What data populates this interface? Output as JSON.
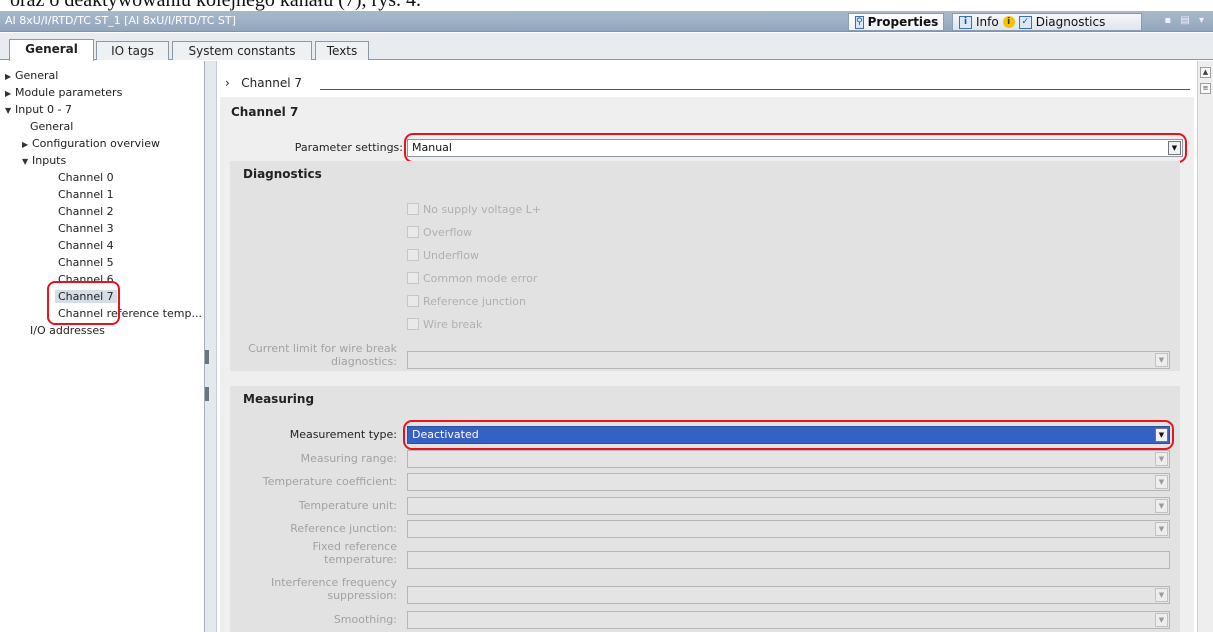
{
  "document_caption": "oraz o deaktywowaniu kolejnego kanału (7), rys. 4.",
  "window": {
    "title": "AI 8xU/I/RTD/TC ST_1 [AI 8xU/I/RTD/TC ST]",
    "tabs": [
      {
        "label": "Properties",
        "icon": "properties-icon"
      },
      {
        "label": "Info",
        "icon": "info-icon"
      },
      {
        "label": "Diagnostics",
        "icon": "diagnostics-icon"
      }
    ]
  },
  "inspector_tabs": [
    "General",
    "IO tags",
    "System constants",
    "Texts"
  ],
  "tree": [
    {
      "label": "General",
      "arrow": "▶"
    },
    {
      "label": "Module parameters",
      "arrow": "▶"
    },
    {
      "label": "Input 0 - 7",
      "arrow": "▼"
    },
    {
      "label": "General",
      "arrow": ""
    },
    {
      "label": "Configuration overview",
      "arrow": "▶"
    },
    {
      "label": "Inputs",
      "arrow": "▼"
    },
    {
      "label": "Channel 0",
      "arrow": ""
    },
    {
      "label": "Channel 1",
      "arrow": ""
    },
    {
      "label": "Channel 2",
      "arrow": ""
    },
    {
      "label": "Channel 3",
      "arrow": ""
    },
    {
      "label": "Channel 4",
      "arrow": ""
    },
    {
      "label": "Channel 5",
      "arrow": ""
    },
    {
      "label": "Channel 6",
      "arrow": ""
    },
    {
      "label": "Channel 7",
      "arrow": ""
    },
    {
      "label": "Channel reference temp...",
      "arrow": ""
    },
    {
      "label": "I/O addresses",
      "arrow": ""
    }
  ],
  "breadcrumb": {
    "arrow": "›",
    "label": "Channel 7"
  },
  "channel": {
    "title": "Channel 7",
    "parameter_settings_label": "Parameter settings:",
    "parameter_settings_value": "Manual"
  },
  "diagnostics": {
    "title": "Diagnostics",
    "checkboxes": [
      "No supply voltage L+",
      "Overflow",
      "Underflow",
      "Common mode error",
      "Reference junction",
      "Wire break"
    ],
    "current_limit_label_1": "Current limit for wire break",
    "current_limit_label_2": "diagnostics:"
  },
  "measuring": {
    "title": "Measuring",
    "measurement_type_label": "Measurement type:",
    "measurement_type_value": "Deactivated",
    "fields": {
      "measuring_range": "Measuring range:",
      "temperature_coefficient": "Temperature coefficient:",
      "temperature_unit": "Temperature unit:",
      "reference_junction": "Reference junction:",
      "fixed_reference_1": "Fixed reference",
      "fixed_reference_2": "temperature:",
      "interference_1": "Interference frequency",
      "interference_2": "suppression:",
      "smoothing": "Smoothing:"
    }
  },
  "colors": {
    "highlight_outline": "#e8141c",
    "selected_combo": "#3561c4"
  }
}
